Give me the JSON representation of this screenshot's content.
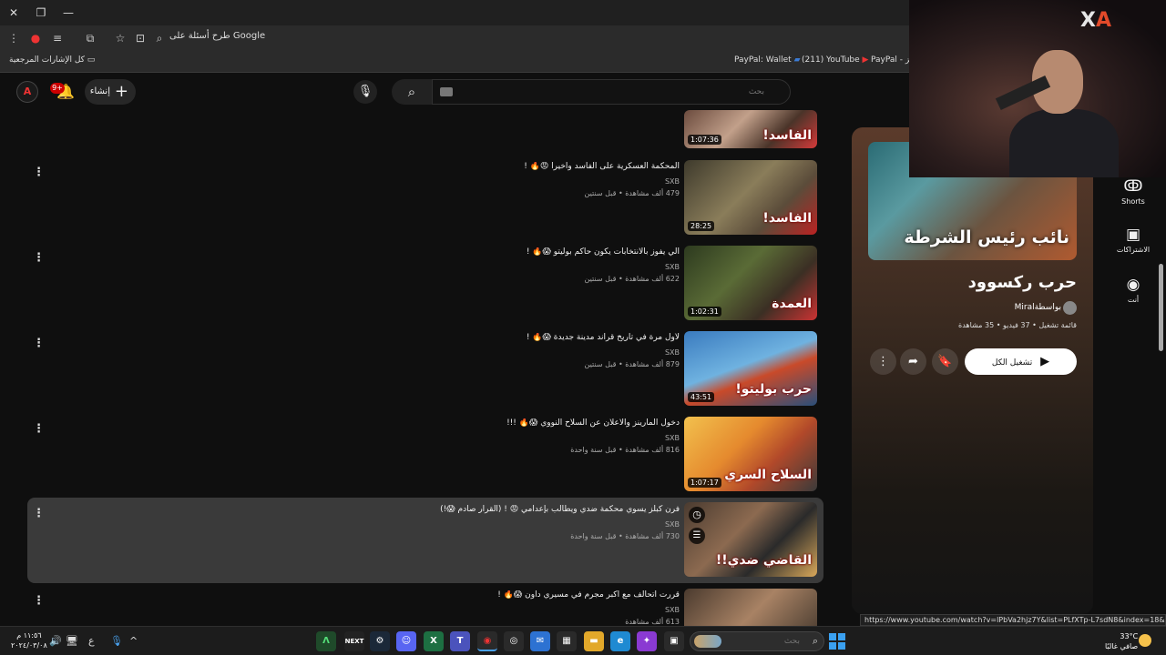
{
  "browser": {
    "address_text": "طرح أسئلة على Google",
    "bookmarks": {
      "all_bookmarks": "كل الإشارات المرجعية",
      "paypal_wallet": "PayPal: Wallet",
      "youtube": "(211) YouTube",
      "paypal_other": "PayPal - ووجز"
    }
  },
  "header": {
    "notif_count": "9+",
    "create_label": "إنشاء",
    "search_placeholder": "بحث"
  },
  "videos": [
    {
      "title": "",
      "channel": "",
      "meta": "",
      "duration": "1:07:36",
      "thumb_text": "الفاسد!"
    },
    {
      "title": "المحكمة العسكرية على الفاسد وأخيرا 😡🔥 !",
      "channel": "SXB",
      "meta": "479 ألف مشاهدة • قبل سنتين",
      "duration": "28:25",
      "thumb_text": "الفاسد!"
    },
    {
      "title": "الي يفوز بالانتخابات يكون حاكم بوليتو 😱🔥 !",
      "channel": "SXB",
      "meta": "622 ألف مشاهدة • قبل سنتين",
      "duration": "1:02:31",
      "thumb_text": "العمدة"
    },
    {
      "title": "لأول مرة في تاريخ قراند مدينة جديدة 😱🔥 !",
      "channel": "SXB",
      "meta": "879 ألف مشاهدة • قبل سنتين",
      "duration": "43:51",
      "thumb_text": "حرب بوليتو!"
    },
    {
      "title": "دخول المارينز والاعلان عن السلاح النووي 😱🔥 !!!",
      "channel": "SXB",
      "meta": "816 ألف مشاهدة • قبل سنة واحدة",
      "duration": "1:07:17",
      "thumb_text": "السلاح السري"
    },
    {
      "title": "فرن كبلز يسوي محكمة ضدي ويطالب بإعدامي 😡 ! (القرار صادم 😱!)",
      "channel": "SXB",
      "meta": "730 ألف مشاهدة • قبل سنة واحدة",
      "duration": "",
      "thumb_text": "القاضي ضدي!!"
    },
    {
      "title": "قررت اتحالف مع أكبر مجرم في مسيري داون 😱🔥 !",
      "channel": "SXB",
      "meta": "613 ألف مشاهدة",
      "duration": "",
      "thumb_text": ""
    }
  ],
  "playlist": {
    "title": "حرب ركسوود",
    "owner": "بواسطةMiral",
    "meta": "قائمة تشغيل • 37 فيديو • 35 مشاهدة",
    "play_all": "تشغيل الكل",
    "thumb_text": "نائب رئيس الشرطة"
  },
  "guide": [
    {
      "label": "Shorts",
      "icon": "shorts-icon"
    },
    {
      "label": "الاشتراكات",
      "icon": "subscriptions-icon"
    },
    {
      "label": "أنت",
      "icon": "you-icon"
    }
  ],
  "status_url": "https://www.youtube.com/watch?v=lPbVa2hjz7Y&list=PLfXTp-L7sdN8&index=18&pp=iAQB",
  "taskbar": {
    "time": "١١:٥٦ م",
    "date": "٢٠٢٤/٠٣/٠٨",
    "lang": "ع",
    "search_placeholder": "بحث",
    "temp": "33°C",
    "weather": "صافي غالبًا"
  },
  "cam_logo": "XA"
}
